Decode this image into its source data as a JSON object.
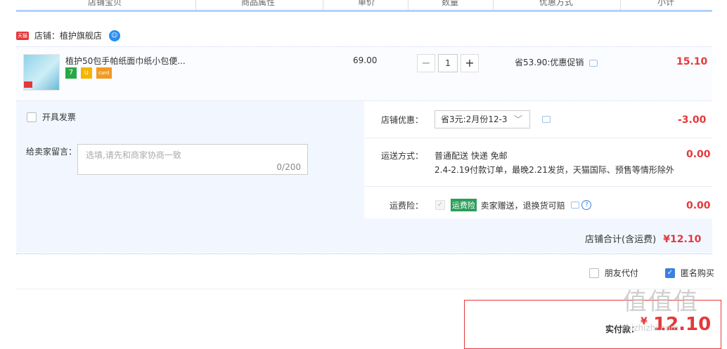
{
  "header": {
    "columns": [
      "店铺宝贝",
      "商品属性",
      "单价",
      "数量",
      "优惠方式",
      "小计"
    ]
  },
  "shop": {
    "tmall_badge": "天猫",
    "label": "店铺：植护旗舰店",
    "wangwang_icon": "wangwang-icon"
  },
  "item": {
    "title": "植护50包手帕纸面巾纸小包便...",
    "price": "69.00",
    "quantity": "1",
    "minus": "−",
    "plus": "+",
    "discount": "省53.90:优惠促销",
    "subtotal": "15.10",
    "badges": [
      "7",
      "u",
      "card"
    ]
  },
  "invoice": {
    "label": "开具发票"
  },
  "message": {
    "label": "给卖家留言：",
    "placeholder": "选填,请先和商家协商一致",
    "count": "0/200"
  },
  "shop_discount": {
    "label": "店铺优惠：",
    "selected": "省3元:2月份12-3",
    "amount": "-3.00"
  },
  "shipping": {
    "label": "运送方式：",
    "method": "普通配送 快递 免邮",
    "note": "2.4-2.19付款订单，最晚2.21发货，天猫国际、预售等情形除外",
    "amount": "0.00"
  },
  "insurance": {
    "label": "运费险：",
    "tag": "运费险",
    "desc": "卖家赠送，退换货可赔",
    "amount": "0.00"
  },
  "shop_total": {
    "label": "店铺合计(含运费)",
    "amount": "¥12.10"
  },
  "options": {
    "friend_pay": "朋友代付",
    "anonymous": "匿名购买"
  },
  "payment": {
    "label": "实付款：",
    "currency": "¥",
    "amount": "12.10"
  },
  "watermark": {
    "logo": "值值值",
    "site": "zhizhizhi.com"
  },
  "colors": {
    "accent_red": "#e4393c",
    "accent_blue": "#3b7fe0",
    "panel_bg": "#f2f7ff"
  }
}
